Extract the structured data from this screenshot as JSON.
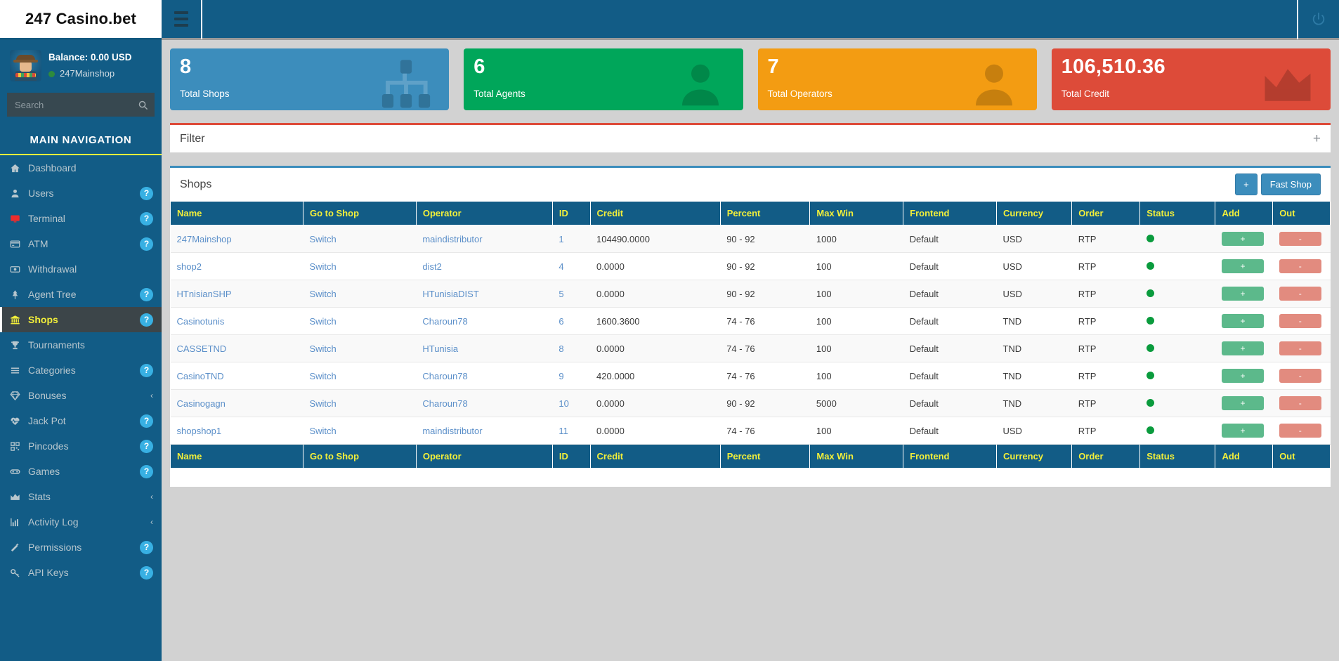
{
  "brand": {
    "title": "247 Casino.bet"
  },
  "topbar": {
    "menu_icon": "hamburger-icon",
    "power_icon": "power-icon"
  },
  "sidebar": {
    "balance": "Balance: 0.00 USD",
    "username": "247Mainshop",
    "status_color": "#2e8b3d",
    "search": {
      "placeholder": "Search",
      "value": "",
      "icon": "search-icon"
    },
    "nav_title": "MAIN NAVIGATION",
    "items": [
      {
        "label": "Dashboard",
        "icon": "home-icon",
        "badge": "",
        "chevron": "",
        "active": false
      },
      {
        "label": "Users",
        "icon": "user-icon",
        "badge": "?",
        "chevron": "",
        "active": false
      },
      {
        "label": "Terminal",
        "icon": "monitor-icon",
        "badge": "?",
        "chevron": "",
        "active": false
      },
      {
        "label": "ATM",
        "icon": "card-icon",
        "badge": "?",
        "chevron": "",
        "active": false
      },
      {
        "label": "Withdrawal",
        "icon": "money-icon",
        "badge": "",
        "chevron": "",
        "active": false
      },
      {
        "label": "Agent Tree",
        "icon": "tree-icon",
        "badge": "?",
        "chevron": "",
        "active": false
      },
      {
        "label": "Shops",
        "icon": "bank-icon",
        "badge": "?",
        "chevron": "",
        "active": true
      },
      {
        "label": "Tournaments",
        "icon": "trophy-icon",
        "badge": "",
        "chevron": "",
        "active": false
      },
      {
        "label": "Categories",
        "icon": "list-icon",
        "badge": "?",
        "chevron": "",
        "active": false
      },
      {
        "label": "Bonuses",
        "icon": "gem-icon",
        "badge": "",
        "chevron": "‹",
        "active": false
      },
      {
        "label": "Jack Pot",
        "icon": "heartbeat-icon",
        "badge": "?",
        "chevron": "",
        "active": false
      },
      {
        "label": "Pincodes",
        "icon": "qrcode-icon",
        "badge": "?",
        "chevron": "",
        "active": false
      },
      {
        "label": "Games",
        "icon": "gamepad-icon",
        "badge": "?",
        "chevron": "",
        "active": false
      },
      {
        "label": "Stats",
        "icon": "area-chart-icon",
        "badge": "",
        "chevron": "‹",
        "active": false
      },
      {
        "label": "Activity Log",
        "icon": "bar-chart-icon",
        "badge": "",
        "chevron": "‹",
        "active": false
      },
      {
        "label": "Permissions",
        "icon": "wand-icon",
        "badge": "?",
        "chevron": "",
        "active": false
      },
      {
        "label": "API Keys",
        "icon": "key-icon",
        "badge": "?",
        "chevron": "",
        "active": false
      }
    ]
  },
  "cards": [
    {
      "value": "8",
      "caption": "Total Shops",
      "color": "#3c8dbc",
      "icon": "sitemap-icon"
    },
    {
      "value": "6",
      "caption": "Total Agents",
      "color": "#00a65a",
      "icon": "user-icon"
    },
    {
      "value": "7",
      "caption": "Total Operators",
      "color": "#f39c12",
      "icon": "user-icon"
    },
    {
      "value": "106,510.36",
      "caption": "Total Credit",
      "color": "#dd4b39",
      "icon": "area-chart-icon"
    }
  ],
  "filter_panel": {
    "title": "Filter",
    "toggle_icon": "plus-icon"
  },
  "shops_panel": {
    "title": "Shops",
    "add_button": "+",
    "fast_shop_button": "Fast Shop",
    "columns": [
      "Name",
      "Go to Shop",
      "Operator",
      "ID",
      "Credit",
      "Percent",
      "Max Win",
      "Frontend",
      "Currency",
      "Order",
      "Status",
      "Add",
      "Out"
    ],
    "row_add_label": "+",
    "row_out_label": "-",
    "rows": [
      {
        "name": "247Mainshop",
        "goto": "Switch",
        "operator": "maindistributor",
        "id": "1",
        "credit": "104490.0000",
        "percent": "90 - 92",
        "max_win": "1000",
        "frontend": "Default",
        "currency": "USD",
        "order": "RTP",
        "status": "online"
      },
      {
        "name": "shop2",
        "goto": "Switch",
        "operator": "dist2",
        "id": "4",
        "credit": "0.0000",
        "percent": "90 - 92",
        "max_win": "100",
        "frontend": "Default",
        "currency": "USD",
        "order": "RTP",
        "status": "online"
      },
      {
        "name": "HTnisianSHP",
        "goto": "Switch",
        "operator": "HTunisiaDIST",
        "id": "5",
        "credit": "0.0000",
        "percent": "90 - 92",
        "max_win": "100",
        "frontend": "Default",
        "currency": "USD",
        "order": "RTP",
        "status": "online"
      },
      {
        "name": "Casinotunis",
        "goto": "Switch",
        "operator": "Charoun78",
        "id": "6",
        "credit": "1600.3600",
        "percent": "74 - 76",
        "max_win": "100",
        "frontend": "Default",
        "currency": "TND",
        "order": "RTP",
        "status": "online"
      },
      {
        "name": "CASSETND",
        "goto": "Switch",
        "operator": "HTunisia",
        "id": "8",
        "credit": "0.0000",
        "percent": "74 - 76",
        "max_win": "100",
        "frontend": "Default",
        "currency": "TND",
        "order": "RTP",
        "status": "online"
      },
      {
        "name": "CasinoTND",
        "goto": "Switch",
        "operator": "Charoun78",
        "id": "9",
        "credit": "420.0000",
        "percent": "74 - 76",
        "max_win": "100",
        "frontend": "Default",
        "currency": "TND",
        "order": "RTP",
        "status": "online"
      },
      {
        "name": "Casinogagn",
        "goto": "Switch",
        "operator": "Charoun78",
        "id": "10",
        "credit": "0.0000",
        "percent": "90 - 92",
        "max_win": "5000",
        "frontend": "Default",
        "currency": "TND",
        "order": "RTP",
        "status": "online"
      },
      {
        "name": "shopshop1",
        "goto": "Switch",
        "operator": "maindistributor",
        "id": "11",
        "credit": "0.0000",
        "percent": "74 - 76",
        "max_win": "100",
        "frontend": "Default",
        "currency": "USD",
        "order": "RTP",
        "status": "online"
      }
    ]
  }
}
